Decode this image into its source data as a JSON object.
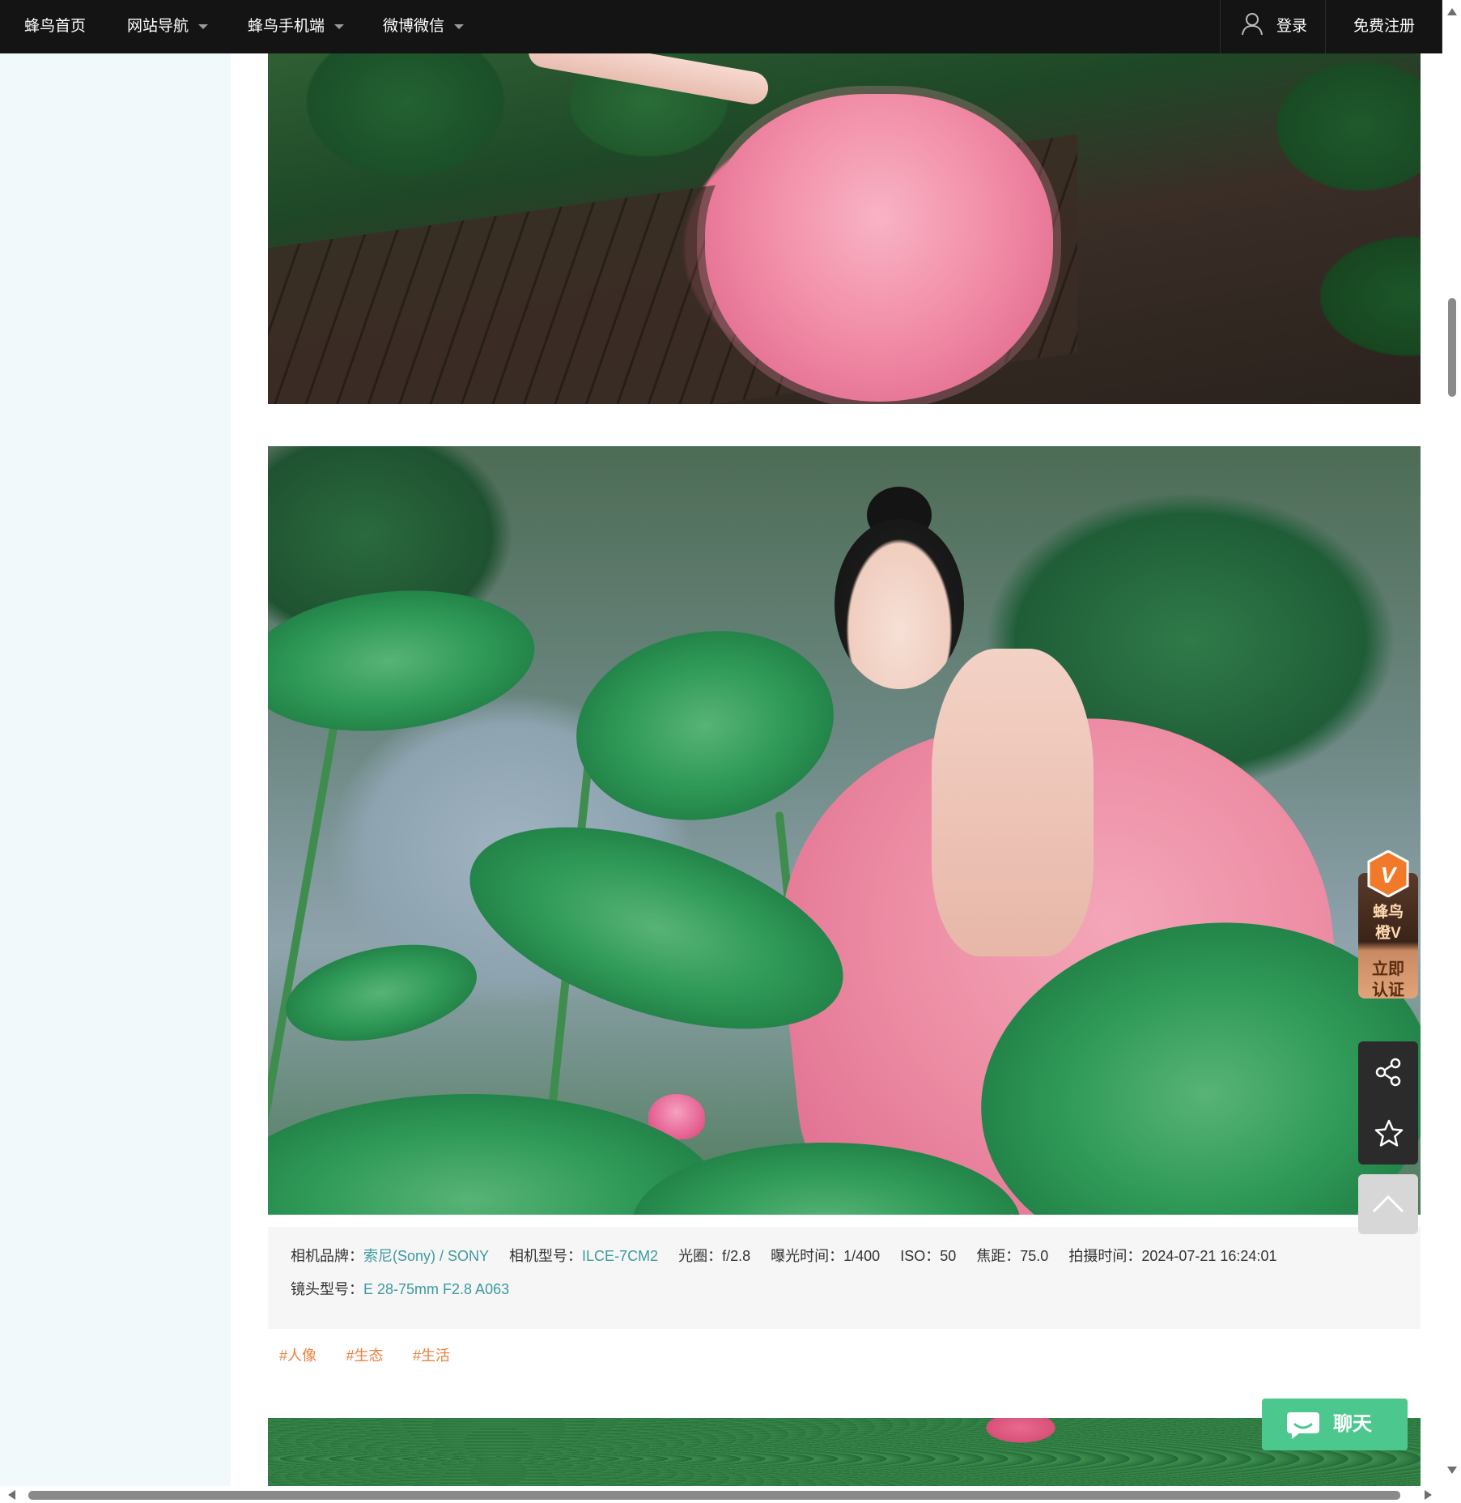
{
  "nav": {
    "home_label": "蜂鸟首页",
    "site_nav_label": "网站导航",
    "mobile_label": "蜂鸟手机端",
    "weibo_label": "微博微信",
    "login_label": "登录",
    "register_label": "免费注册",
    "user_icon": "user-icon",
    "caret_icon": "chevron-down-icon"
  },
  "photos": [
    {
      "icon": "photo-lotus-girl-seated"
    },
    {
      "icon": "photo-lotus-girl-kneeling"
    },
    {
      "icon": "photo-lotus-pond"
    }
  ],
  "exif": {
    "brand_label": "相机品牌：",
    "brand_value": "索尼(Sony) / SONY",
    "model_label": "相机型号：",
    "model_value": "ILCE-7CM2",
    "aperture_label": "光圈：",
    "aperture_value": "f/2.8",
    "exposure_label": "曝光时间：",
    "exposure_value": "1/400",
    "iso_label": "ISO：",
    "iso_value": "50",
    "focal_label": "焦距：",
    "focal_value": "75.0",
    "time_label": "拍摄时间：",
    "time_value": "2024-07-21 16:24:01",
    "lens_label": "镜头型号：",
    "lens_value": "E 28-75mm F2.8 A063"
  },
  "tags": [
    "#人像",
    "#生态",
    "#生活"
  ],
  "float_tools": {
    "vip_line1": "蜂鸟",
    "vip_line2": "橙V",
    "vip_cta_line1": "立即",
    "vip_cta_line2": "认证",
    "vip_badge_letter": "V",
    "share_icon": "share-icon",
    "favorite_icon": "star-icon",
    "top_icon": "chevron-up-icon"
  },
  "chat": {
    "label": "聊天",
    "icon": "chat-bubble-icon"
  },
  "colors": {
    "nav_bg": "#141414",
    "sidebar_bg": "#f1f9fb",
    "link_teal": "#3c9aa0",
    "tag_orange": "#e8813e",
    "chat_green": "#4cc78e",
    "vip_orange": "#f07a2a"
  }
}
